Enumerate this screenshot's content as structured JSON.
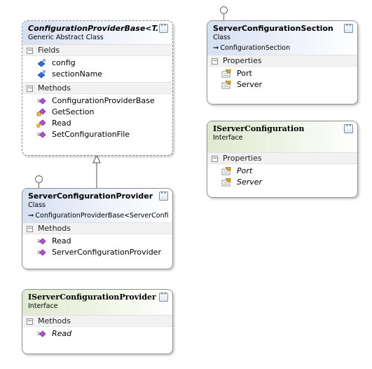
{
  "diagram": {
    "shapes": {
      "configuration_provider_base": {
        "name": "ConfigurationProviderBase<T...",
        "kind": "Generic Abstract Class",
        "fields_label": "Fields",
        "fields": [
          "config",
          "sectionName"
        ],
        "methods_label": "Methods",
        "methods": [
          "ConfigurationProviderBase",
          "GetSection",
          "Read",
          "SetConfigurationFile"
        ]
      },
      "server_configuration_provider": {
        "name": "ServerConfigurationProvider",
        "kind": "Class",
        "base": "ConfigurationProviderBase<ServerConfig...",
        "methods_label": "Methods",
        "methods": [
          "Read",
          "ServerConfigurationProvider"
        ]
      },
      "iserver_configuration_provider": {
        "name": "IServerConfigurationProvider",
        "kind": "Interface",
        "methods_label": "Methods",
        "methods": [
          "Read"
        ]
      },
      "server_configuration_section": {
        "name": "ServerConfigurationSection",
        "kind": "Class",
        "base": "ConfigurationSection",
        "properties_label": "Properties",
        "properties": [
          "Port",
          "Server"
        ]
      },
      "iserver_configuration": {
        "name": "IServerConfiguration",
        "kind": "Interface",
        "properties_label": "Properties",
        "properties": [
          "Port",
          "Server"
        ]
      }
    },
    "icons": {
      "collapse": "chevron-up-double-icon",
      "section_toggle": "minus-box-icon",
      "field": "field-icon",
      "method": "method-icon",
      "protected_method": "protected-method-icon",
      "virtual_method": "virtual-method-icon",
      "property": "property-icon",
      "base_arrow": "inheritance-arrow-icon"
    },
    "colors": {
      "class_header": "#d6e0f3",
      "interface_header": "#dfe9cf",
      "method_icon": "#b14fd6",
      "field_icon": "#2f6fd6",
      "property_icon": "#d9a520",
      "shape_border": "#8f8f8f"
    }
  }
}
